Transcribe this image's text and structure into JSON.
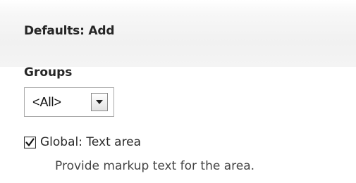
{
  "header": {
    "title": "Defaults: Add"
  },
  "groups": {
    "label": "Groups",
    "selected": "<All>"
  },
  "option": {
    "checked": true,
    "label": "Global: Text area",
    "description": "Provide markup text for the area."
  },
  "icons": {
    "dropdown": "dropdown-arrow-icon",
    "checkbox": "checkbox-checked-icon"
  }
}
